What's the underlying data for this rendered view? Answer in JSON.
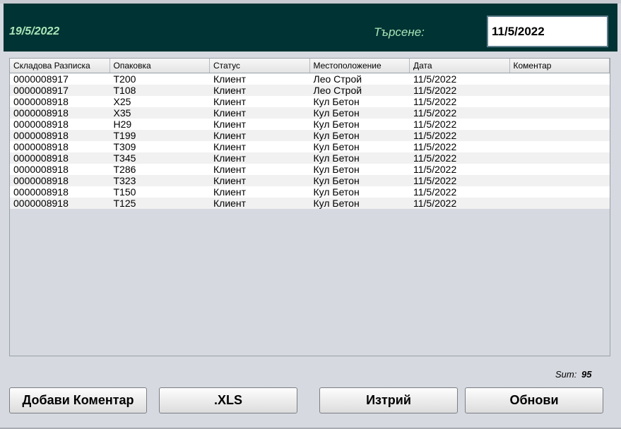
{
  "header": {
    "date": "19/5/2022",
    "search_label": "Търсене:",
    "search_value": "11/5/2022"
  },
  "table": {
    "columns": [
      "Складова Разписка",
      "Опаковка",
      "Статус",
      "Местоположение",
      "Дата",
      "Коментар"
    ],
    "rows": [
      [
        "0000008917",
        "T200",
        "Клиент",
        "Лео Строй",
        "11/5/2022",
        ""
      ],
      [
        "0000008917",
        "T108",
        "Клиент",
        "Лео Строй",
        "11/5/2022",
        ""
      ],
      [
        "0000008918",
        "X25",
        "Клиент",
        "Кул Бетон",
        "11/5/2022",
        ""
      ],
      [
        "0000008918",
        "X35",
        "Клиент",
        "Кул Бетон",
        "11/5/2022",
        ""
      ],
      [
        "0000008918",
        "H29",
        "Клиент",
        "Кул Бетон",
        "11/5/2022",
        ""
      ],
      [
        "0000008918",
        "T199",
        "Клиент",
        "Кул Бетон",
        "11/5/2022",
        ""
      ],
      [
        "0000008918",
        "T309",
        "Клиент",
        "Кул Бетон",
        "11/5/2022",
        ""
      ],
      [
        "0000008918",
        "T345",
        "Клиент",
        "Кул Бетон",
        "11/5/2022",
        ""
      ],
      [
        "0000008918",
        "T286",
        "Клиент",
        "Кул Бетон",
        "11/5/2022",
        ""
      ],
      [
        "0000008918",
        "T323",
        "Клиент",
        "Кул Бетон",
        "11/5/2022",
        ""
      ],
      [
        "0000008918",
        "T150",
        "Клиент",
        "Кул Бетон",
        "11/5/2022",
        ""
      ],
      [
        "0000008918",
        "T125",
        "Клиент",
        "Кул Бетон",
        "11/5/2022",
        ""
      ]
    ]
  },
  "summary": {
    "sum_label": "Sum:",
    "sum_value": "95"
  },
  "buttons": {
    "add_comment": "Добави Коментар",
    "export_xls": ".XLS",
    "delete": "Изтрий",
    "refresh": "Обнови"
  },
  "colors": {
    "header_bg": "#003333",
    "header_text": "#a8e6b8",
    "window_bg": "#d6d9e0"
  }
}
